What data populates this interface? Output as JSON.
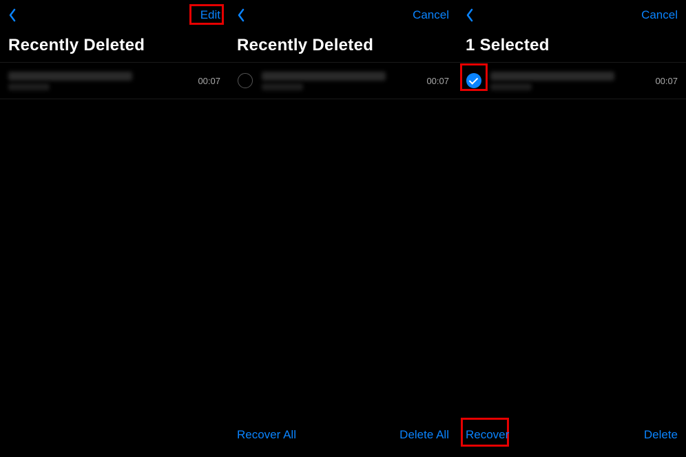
{
  "accent": "#0a84ff",
  "p1": {
    "nav": {
      "edit": "Edit"
    },
    "title": "Recently Deleted",
    "row": {
      "duration": "00:07"
    }
  },
  "p2": {
    "nav": {
      "cancel": "Cancel"
    },
    "title": "Recently Deleted",
    "row": {
      "duration": "00:07"
    },
    "toolbar": {
      "left": "Recover All",
      "right": "Delete All"
    }
  },
  "p3": {
    "nav": {
      "cancel": "Cancel"
    },
    "title": "1 Selected",
    "row": {
      "duration": "00:07"
    },
    "toolbar": {
      "left": "Recover",
      "right": "Delete"
    }
  }
}
